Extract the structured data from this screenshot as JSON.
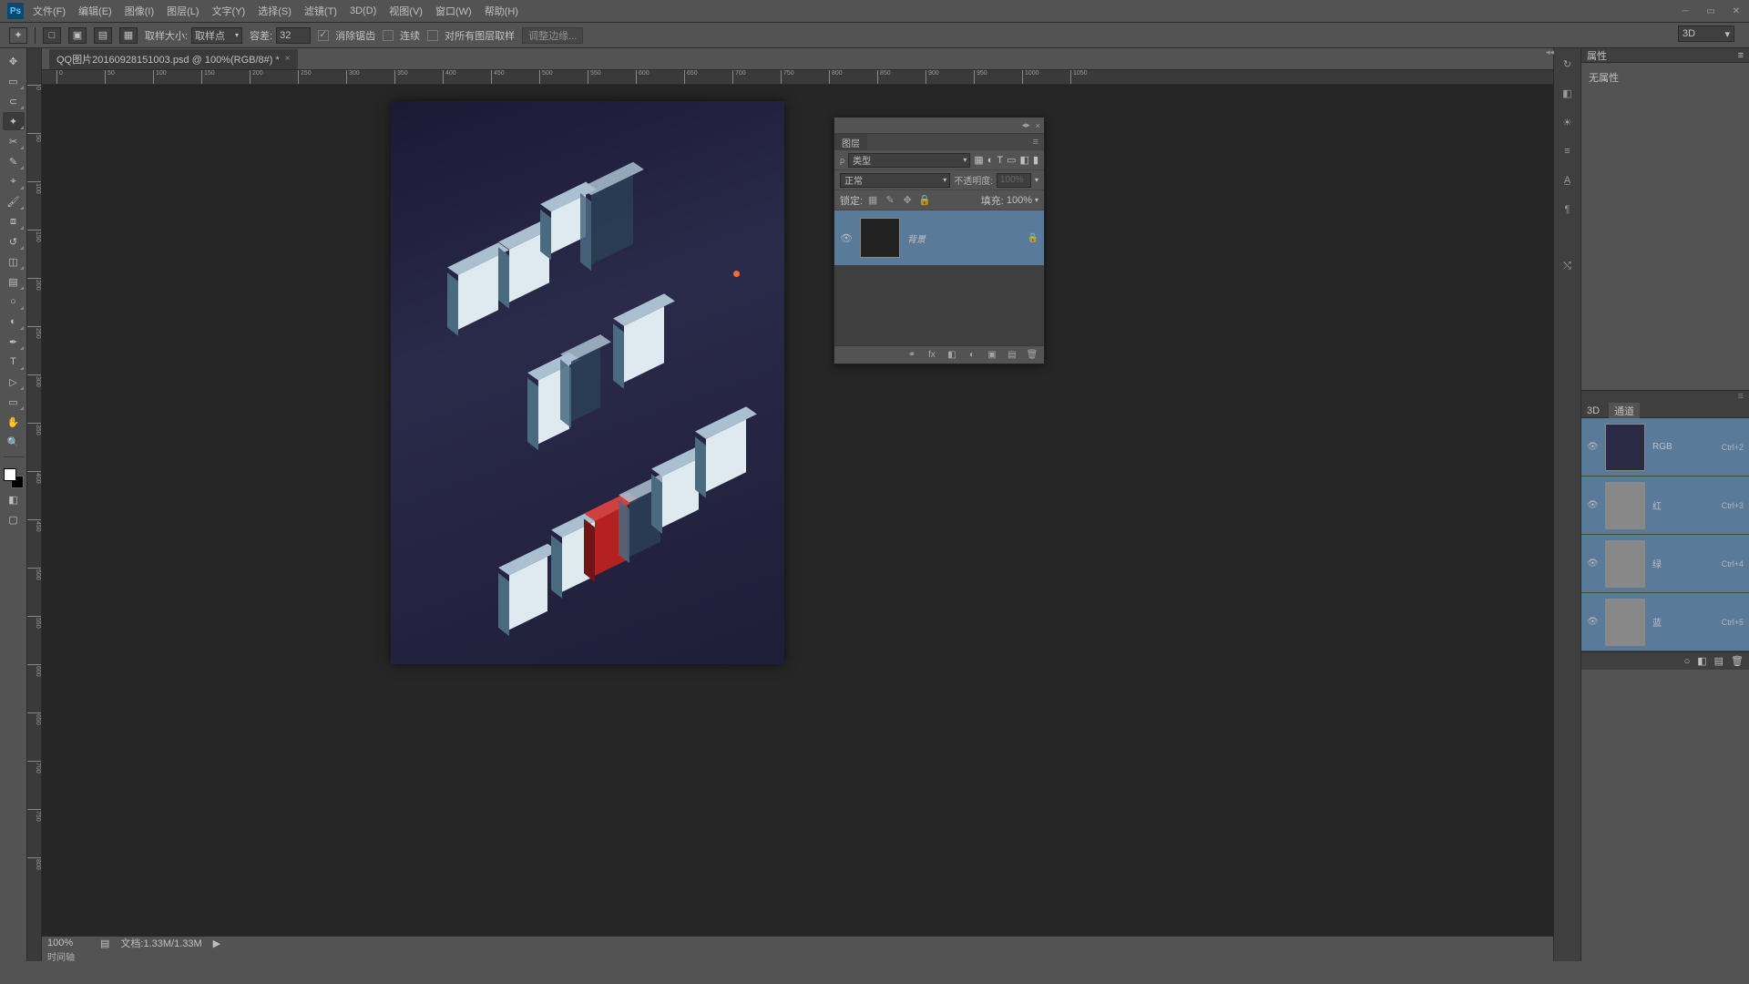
{
  "menu": {
    "items": [
      "文件(F)",
      "编辑(E)",
      "图像(I)",
      "图层(L)",
      "文字(Y)",
      "选择(S)",
      "滤镜(T)",
      "3D(D)",
      "视图(V)",
      "窗口(W)",
      "帮助(H)"
    ]
  },
  "options": {
    "sample_size_lbl": "取样大小:",
    "sample_size_val": "取样点",
    "tolerance_lbl": "容差:",
    "tolerance_val": "32",
    "anti_alias": "消除锯齿",
    "contiguous": "连续",
    "sample_all": "对所有图层取样",
    "adjust_edge": "调整边缘...",
    "threed": "3D"
  },
  "doc": {
    "tab_title": "QQ图片20160928151003.psd @ 100%(RGB/8#) *"
  },
  "status": {
    "zoom": "100%",
    "doc_size": "文档:1.33M/1.33M",
    "timeline": "时间轴"
  },
  "layers_panel": {
    "title": "图层",
    "kind_lbl": "类型",
    "blend": "正常",
    "opacity_lbl": "不透明度:",
    "opacity_val": "100%",
    "lock_lbl": "锁定:",
    "fill_lbl": "填充:",
    "fill_val": "100%",
    "bg_layer": "背景"
  },
  "properties": {
    "title": "属性",
    "none": "无属性"
  },
  "channels": {
    "tab_3d": "3D",
    "tab_ch": "通道",
    "items": [
      {
        "name": "RGB",
        "key": "Ctrl+2"
      },
      {
        "name": "红",
        "key": "Ctrl+3"
      },
      {
        "name": "绿",
        "key": "Ctrl+4"
      },
      {
        "name": "蓝",
        "key": "Ctrl+5"
      }
    ]
  },
  "ruler_h": [
    0,
    50,
    100,
    150,
    200,
    250,
    300,
    350,
    400,
    450,
    500,
    550,
    600,
    650,
    700,
    750,
    800,
    850,
    900,
    950,
    1000,
    1050
  ],
  "ruler_v": [
    0,
    50,
    100,
    150,
    200,
    250,
    300,
    350,
    400,
    450,
    500,
    550,
    600,
    650,
    700,
    750,
    800
  ]
}
